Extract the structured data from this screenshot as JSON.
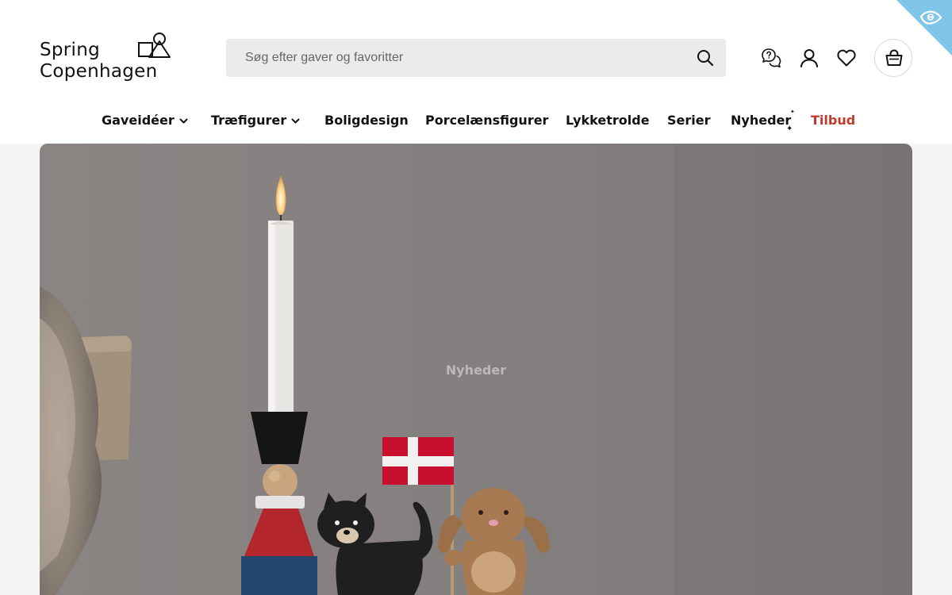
{
  "brand": {
    "name_line1": "Spring",
    "name_line2": "Copenhagen"
  },
  "search": {
    "placeholder": "Søg efter gaver og favoritter"
  },
  "header_icons": [
    "chat-help-icon",
    "user-icon",
    "heart-icon",
    "shopping-bag-icon"
  ],
  "nav": {
    "items": [
      {
        "label": "Gaveidéer",
        "has_dropdown": true
      },
      {
        "label": "Træfigurer",
        "has_dropdown": true
      },
      {
        "label": "Boligdesign",
        "has_dropdown": false
      },
      {
        "label": "Porcelænsfigurer",
        "has_dropdown": false
      },
      {
        "label": "Lykketrolde",
        "has_dropdown": false
      },
      {
        "label": "Serier",
        "has_dropdown": false
      },
      {
        "label": "Nyheder",
        "has_dropdown": false
      },
      {
        "label": "Tilbud",
        "has_dropdown": false
      }
    ]
  },
  "hero": {
    "label": "Nyheder"
  },
  "colors": {
    "sale": "#c0392b",
    "accessibility_badge": "#7fc6e8",
    "flag_red": "#c8102e"
  }
}
